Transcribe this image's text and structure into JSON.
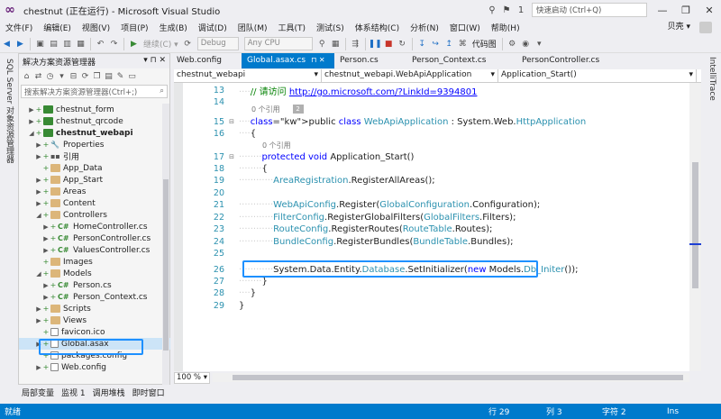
{
  "window": {
    "title": "chestnut (正在运行) - Microsoft Visual Studio",
    "quick_launch": "快速启动 (Ctrl+Q)",
    "notification_count": "1",
    "minimize": "—",
    "restore": "❐",
    "close": "✕"
  },
  "menu": {
    "items": [
      "文件(F)",
      "编辑(E)",
      "视图(V)",
      "项目(P)",
      "生成(B)",
      "调试(D)",
      "团队(M)",
      "工具(T)",
      "测试(S)",
      "体系结构(C)",
      "分析(N)",
      "窗口(W)",
      "帮助(H)"
    ],
    "user": "贝壳 ▾"
  },
  "toolbar": {
    "continue_label": "继续(C) ▾",
    "config": "Debug",
    "platform": "Any CPU",
    "code_map": "代码图"
  },
  "left_strip": {
    "label": "SQL Server 对象资源管理器"
  },
  "right_strip": {
    "label": "IntelliTrace"
  },
  "solution_explorer": {
    "title": "解决方案资源管理器",
    "title_buttons": "▾ ⊓ ✕",
    "search_placeholder": "搜索解决方案资源管理器(Ctrl+;)",
    "search_icon": "⌕",
    "tree": [
      {
        "label": "chestnut_form",
        "icon": "proj",
        "arrow": "▶",
        "indent": 1
      },
      {
        "label": "chestnut_qrcode",
        "icon": "proj",
        "arrow": "▶",
        "indent": 1
      },
      {
        "label": "chestnut_webapi",
        "icon": "proj",
        "arrow": "◢",
        "indent": 1,
        "bold": true
      },
      {
        "label": "Properties",
        "icon": "wrench",
        "arrow": "▶",
        "indent": 2
      },
      {
        "label": "引用",
        "icon": "ref",
        "arrow": "▶",
        "indent": 2
      },
      {
        "label": "App_Data",
        "icon": "folder",
        "arrow": "",
        "indent": 2
      },
      {
        "label": "App_Start",
        "icon": "folder",
        "arrow": "▶",
        "indent": 2
      },
      {
        "label": "Areas",
        "icon": "folder",
        "arrow": "▶",
        "indent": 2
      },
      {
        "label": "Content",
        "icon": "folder",
        "arrow": "▶",
        "indent": 2
      },
      {
        "label": "Controllers",
        "icon": "folder",
        "arrow": "◢",
        "indent": 2
      },
      {
        "label": "HomeController.cs",
        "icon": "cs",
        "arrow": "▶",
        "indent": 3
      },
      {
        "label": "PersonController.cs",
        "icon": "cs",
        "arrow": "▶",
        "indent": 3
      },
      {
        "label": "ValuesController.cs",
        "icon": "cs",
        "arrow": "▶",
        "indent": 3
      },
      {
        "label": "Images",
        "icon": "folder",
        "arrow": "",
        "indent": 2
      },
      {
        "label": "Models",
        "icon": "folder",
        "arrow": "◢",
        "indent": 2
      },
      {
        "label": "Person.cs",
        "icon": "cs",
        "arrow": "▶",
        "indent": 3
      },
      {
        "label": "Person_Context.cs",
        "icon": "cs",
        "arrow": "▶",
        "indent": 3
      },
      {
        "label": "Scripts",
        "icon": "folder",
        "arrow": "▶",
        "indent": 2
      },
      {
        "label": "Views",
        "icon": "folder",
        "arrow": "▶",
        "indent": 2
      },
      {
        "label": "favicon.ico",
        "icon": "file",
        "arrow": "",
        "indent": 2
      },
      {
        "label": "Global.asax",
        "icon": "file",
        "arrow": "▶",
        "indent": 2,
        "selected": true
      },
      {
        "label": "packages.config",
        "icon": "file",
        "arrow": "",
        "indent": 2
      },
      {
        "label": "Web.config",
        "icon": "file",
        "arrow": "▶",
        "indent": 2
      }
    ]
  },
  "tabs": [
    {
      "label": "Web.config",
      "active": false
    },
    {
      "label": "Global.asax.cs",
      "active": true,
      "close": "⊓ ✕"
    },
    {
      "label": "Person.cs",
      "active": false
    },
    {
      "label": "Person_Context.cs",
      "active": false
    },
    {
      "label": "PersonController.cs",
      "active": false
    }
  ],
  "nav": {
    "project": "chestnut_webapi",
    "class": "chestnut_webapi.WebApiApplication",
    "member": "Application_Start()"
  },
  "code": {
    "ref_hint": "0 个引用",
    "peek": "2",
    "lines": [
      {
        "n": "13",
        "text": "// 请访问 ",
        "link": "http://go.microsoft.com/?LinkId=9394801"
      },
      {
        "n": "14",
        "text": ""
      },
      {
        "n": "15",
        "text": "public class WebApiApplication : System.Web.HttpApplication"
      },
      {
        "n": "16",
        "text": "{"
      },
      {
        "n": "17",
        "text": "protected void Application_Start()"
      },
      {
        "n": "18",
        "text": "{"
      },
      {
        "n": "19",
        "text": "AreaRegistration.RegisterAllAreas();"
      },
      {
        "n": "20",
        "text": ""
      },
      {
        "n": "21",
        "text": "WebApiConfig.Register(GlobalConfiguration.Configuration);"
      },
      {
        "n": "22",
        "text": "FilterConfig.RegisterGlobalFilters(GlobalFilters.Filters);"
      },
      {
        "n": "23",
        "text": "RouteConfig.RegisterRoutes(RouteTable.Routes);"
      },
      {
        "n": "24",
        "text": "BundleConfig.RegisterBundles(BundleTable.Bundles);"
      },
      {
        "n": "25",
        "text": ""
      },
      {
        "n": "26",
        "text": "System.Data.Entity.Database.SetInitializer(new Models.Db_Initer());"
      },
      {
        "n": "27",
        "text": "}"
      },
      {
        "n": "28",
        "text": "}"
      },
      {
        "n": "29",
        "text": "}"
      }
    ]
  },
  "zoom": "100 % ▾",
  "bottom_tabs": [
    "局部变量",
    "监视 1",
    "调用堆栈",
    "即时窗口"
  ],
  "status": {
    "left": "就绪",
    "line": "行 29",
    "col": "列 3",
    "ch": "字符 2",
    "ins": "Ins"
  }
}
